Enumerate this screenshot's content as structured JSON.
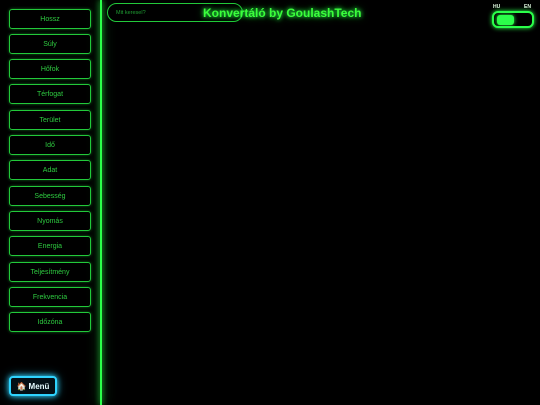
{
  "header": {
    "title": "Konvertáló by GoulashTech",
    "search_placeholder": "Mit keresel?"
  },
  "language": {
    "left": "HU",
    "right": "EN",
    "selected": "HU"
  },
  "sidebar": {
    "items": [
      {
        "label": "Hossz"
      },
      {
        "label": "Súly"
      },
      {
        "label": "Hőfok"
      },
      {
        "label": "Térfogat"
      },
      {
        "label": "Terület"
      },
      {
        "label": "Idő"
      },
      {
        "label": "Adat"
      },
      {
        "label": "Sebesség"
      },
      {
        "label": "Nyomás"
      },
      {
        "label": "Energia"
      },
      {
        "label": "Teljesítmény"
      },
      {
        "label": "Frekvencia"
      },
      {
        "label": "Időzóna"
      }
    ],
    "menu_label": "Menü",
    "menu_icon": "home-icon"
  },
  "colors": {
    "accent": "#2bff4a",
    "menu_accent": "#2fd4ff",
    "background": "#000000"
  }
}
